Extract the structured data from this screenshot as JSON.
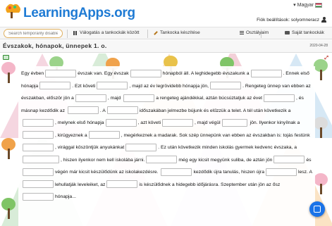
{
  "header": {
    "logo_text": "LearningApps.org",
    "language": "Magyar",
    "account_label": "Fiók beállítások: solyomneracz"
  },
  "nav": {
    "search_placeholder": "Search temporarily disabled",
    "browse_label": "Válogatás a tankockák között",
    "create_label": "Tankocka készítése",
    "classes_label": "Osztályaim",
    "my_apps_label": "Saját tankockák"
  },
  "page": {
    "title": "Évszakok, hónapok, ünnepek 1. o.",
    "date": "2020-04-28"
  },
  "exercise": {
    "segments": [
      "Egy évben",
      "évszak van. Egy évszak",
      "hónapból áll. A leghidegebb évszakunk",
      "a",
      ". Ennek első hónapja",
      ". Ezt követi",
      ", majd az év legrövidebb",
      "hónapja jön,",
      ". Rengeteg ünnep van ebben az évszakban, először jön a",
      ", majd",
      "a rengeteg ajándékkal, aztán búcsúztatjuk az évet",
      ", és másnap kezdődik az",
      ". A",
      "időszakában jelmezbe bújunk és elűzzük a telet. A tél után következik a",
      ", melynek első hónapja",
      ", azt követi",
      ", majd végül",
      "jön. Ilyenkor kinyílnak a",
      ", kirügyeznek a",
      ", megérkeznek a",
      "madarak. Sok szép ünnepünk van ebben az évszakban is: tojás festünk",
      ", virággal",
      "köszöntjük anyukánkat",
      ". Ez után következik minden iskolás gyermek kedvenc évszaka, a",
      ", hiszen ilyenkor nem kell iskolába járni.",
      "még egy kicsit megyünk suliba, de",
      "aztán jön",
      "és",
      "végén már kicsit készülődünk az iskolakezdésre.",
      "kezdődik újra tanulás, hiszen újra",
      "lesz. A",
      "lehullatják leveleiket,",
      "az",
      "is készülődnek a hidegebb időjárásra. Szeptember után jön az ősz",
      "hónapja..."
    ]
  },
  "colors": {
    "logo_blue": "#1f7bd4",
    "fab_blue": "#1a73e8",
    "search_border": "#e0b060"
  }
}
